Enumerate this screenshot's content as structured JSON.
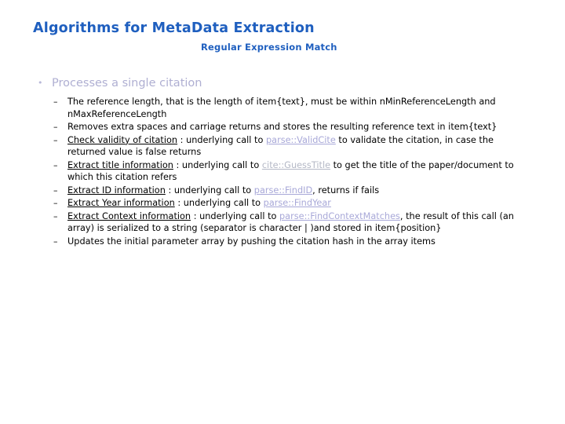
{
  "slide": {
    "title": "Algorithms for MetaData Extraction",
    "subtitle": "Regular Expression Match",
    "colors": {
      "title": "#1F5FBF",
      "level1_text": "#AFAFD2",
      "body_text": "#000000",
      "link": "#A8A8D8",
      "link_gray": "#B4B8C6",
      "background": "#FFFFFF"
    },
    "level1": {
      "marker": "•",
      "text": "Processes a single citation"
    },
    "level2_marker": "–",
    "bullets": [
      {
        "id": "reference-length",
        "parts": [
          {
            "kind": "text",
            "value": "The reference length, that is the length of item{text}, must be within nMinReferenceLength and nMaxReferenceLength"
          }
        ]
      },
      {
        "id": "remove-extra-spaces",
        "parts": [
          {
            "kind": "text",
            "value": "Removes extra spaces and carriage returns and stores the resulting reference text in item{text}"
          }
        ]
      },
      {
        "id": "check-validity",
        "parts": [
          {
            "kind": "heading",
            "value": "Check validity of citation"
          },
          {
            "kind": "text",
            "value": " : underlying call to "
          },
          {
            "kind": "link",
            "value": "parse::ValidCite"
          },
          {
            "kind": "text",
            "value": " to validate the citation, in case the returned value is false returns"
          }
        ]
      },
      {
        "id": "extract-title",
        "parts": [
          {
            "kind": "heading",
            "value": "Extract title information"
          },
          {
            "kind": "text",
            "value": " : underlying call to "
          },
          {
            "kind": "link-gray",
            "value": "cite::GuessTitle"
          },
          {
            "kind": "text",
            "value": " to get the title of the paper/document to which this citation refers"
          }
        ]
      },
      {
        "id": "extract-id",
        "parts": [
          {
            "kind": "heading",
            "value": "Extract ID information"
          },
          {
            "kind": "text",
            "value": " : underlying call to "
          },
          {
            "kind": "link",
            "value": "parse::FindID"
          },
          {
            "kind": "text",
            "value": ", returns if fails"
          }
        ]
      },
      {
        "id": "extract-year",
        "parts": [
          {
            "kind": "heading",
            "value": "Extract Year information"
          },
          {
            "kind": "text",
            "value": " : underlying call to "
          },
          {
            "kind": "link",
            "value": "parse::FindYear"
          }
        ]
      },
      {
        "id": "extract-context",
        "parts": [
          {
            "kind": "heading",
            "value": "Extract Context information"
          },
          {
            "kind": "text",
            "value": " : underlying call to "
          },
          {
            "kind": "link",
            "value": "parse::FindContextMatches"
          },
          {
            "kind": "text",
            "value": ", the result of this call (an array) is serialized to a string (separator is character | )and stored in item{position}"
          }
        ]
      },
      {
        "id": "update-parameter-array",
        "parts": [
          {
            "kind": "text",
            "value": "Updates the initial parameter array by pushing the citation hash in the array items"
          }
        ]
      }
    ]
  }
}
